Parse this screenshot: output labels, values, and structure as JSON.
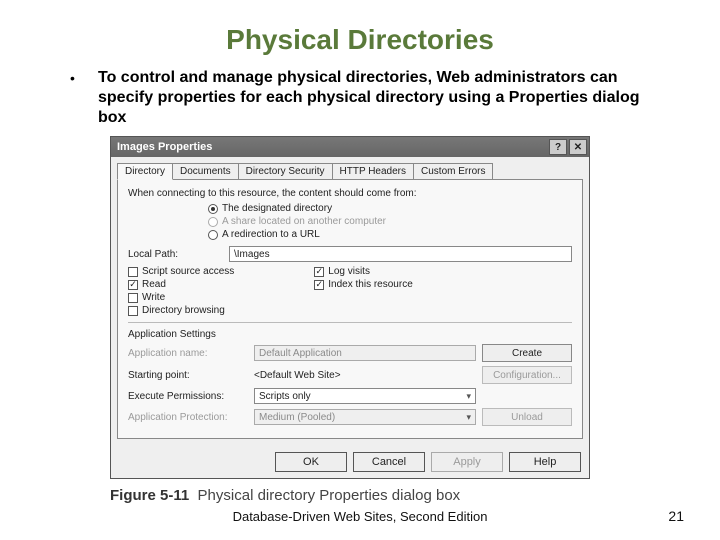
{
  "slide": {
    "title": "Physical Directories",
    "bullet": "To control and manage physical directories, Web administrators can specify properties for each physical directory using a Properties dialog box",
    "footer": "Database-Driven Web Sites, Second Edition",
    "page": "21"
  },
  "dialog": {
    "title": "Images Properties",
    "help_btn": "?",
    "close_btn": "✕",
    "tabs": [
      "Directory",
      "Documents",
      "Directory Security",
      "HTTP Headers",
      "Custom Errors"
    ],
    "connect_label": "When connecting to this resource, the content should come from:",
    "radios": {
      "r1": "The designated directory",
      "r2": "A share located on another computer",
      "r3": "A redirection to a URL"
    },
    "local_path_label": "Local Path:",
    "local_path_value": "\\Images",
    "checks_left": [
      "Script source access",
      "Read",
      "Write",
      "Directory browsing"
    ],
    "checks_right": [
      "Log visits",
      "Index this resource"
    ],
    "app_section": "Application Settings",
    "app_name_label": "Application name:",
    "app_name_value": "Default Application",
    "start_label": "Starting point:",
    "start_value": "<Default Web Site>",
    "exec_label": "Execute Permissions:",
    "exec_value": "Scripts only",
    "prot_label": "Application Protection:",
    "prot_value": "Medium (Pooled)",
    "btn_create": "Create",
    "btn_config": "Configuration...",
    "btn_unload": "Unload",
    "buttons": {
      "ok": "OK",
      "cancel": "Cancel",
      "apply": "Apply",
      "help": "Help"
    }
  },
  "figure": {
    "label": "Figure 5-11",
    "caption": "Physical directory Properties dialog box"
  }
}
